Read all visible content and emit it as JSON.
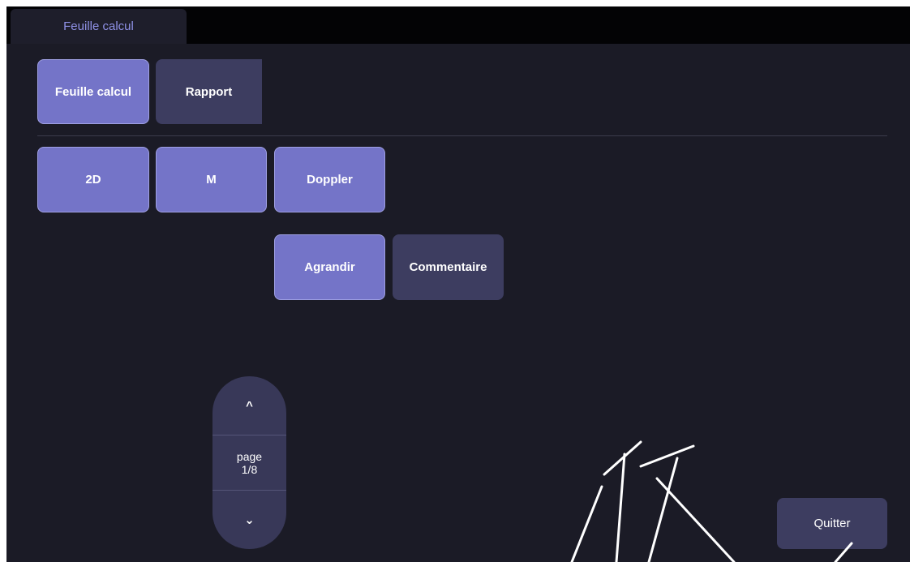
{
  "tab": {
    "label": "Feuille calcul"
  },
  "mode_buttons": {
    "worksheet": "Feuille calcul",
    "report": "Rapport"
  },
  "category_buttons": {
    "b2d": "2D",
    "m": "M",
    "doppler": "Doppler"
  },
  "action_buttons": {
    "enlarge": "Agrandir",
    "comment": "Commentaire"
  },
  "pager": {
    "up_icon": "^",
    "label": "page",
    "current": "1/8",
    "down_icon": "⌄"
  },
  "footer": {
    "quit": "Quitter"
  },
  "colors": {
    "background": "#1b1b26",
    "tabbar": "#030305",
    "tab_text": "#8f91e6",
    "active_button": "#7474c8",
    "inactive_button": "#3d3d60"
  }
}
